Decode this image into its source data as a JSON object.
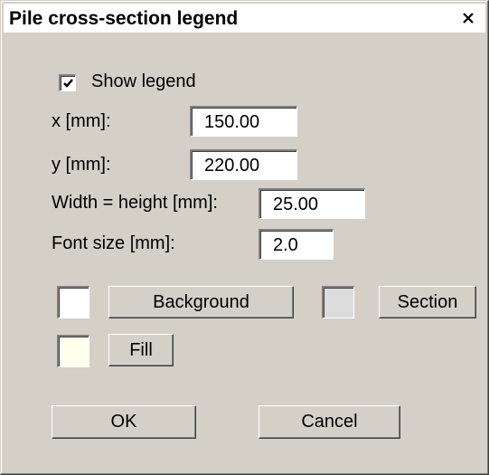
{
  "window": {
    "title": "Pile cross-section legend",
    "close_symbol": "X"
  },
  "show_legend": {
    "label": "Show legend",
    "checked": true
  },
  "fields": {
    "x": {
      "label": "x [mm]:",
      "value": "150.00"
    },
    "y": {
      "label": "y [mm]:",
      "value": "220.00"
    },
    "width_height": {
      "label": "Width = height [mm]:",
      "value": "25.00"
    },
    "font_size": {
      "label": "Font size [mm]:",
      "value": "2.0"
    }
  },
  "colors": {
    "dialog_face": "#d4d0c8",
    "background_swatch": "#ffffff",
    "section_swatch": "#dcdcdc",
    "fill_swatch": "#ffffee"
  },
  "buttons": {
    "background": "Background",
    "section": "Section",
    "fill": "Fill",
    "ok": "OK",
    "cancel": "Cancel"
  }
}
